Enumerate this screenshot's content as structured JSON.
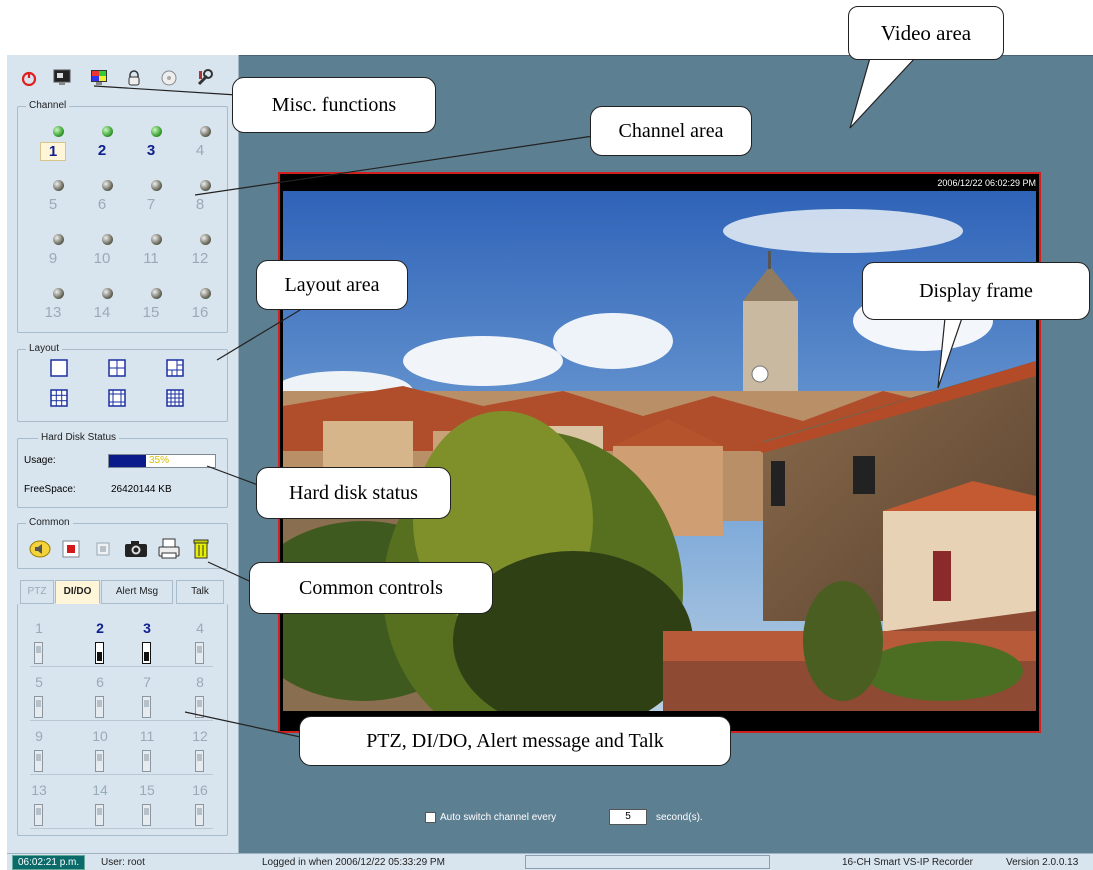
{
  "misc": {
    "icons": [
      "power-icon",
      "monitor-icon",
      "color-monitor-icon",
      "lock-icon",
      "disc-icon",
      "tools-icon"
    ]
  },
  "channel": {
    "title": "Channel",
    "items": [
      {
        "n": "1",
        "led": "on",
        "active": true,
        "selected": true
      },
      {
        "n": "2",
        "led": "on",
        "active": true
      },
      {
        "n": "3",
        "led": "on",
        "active": true
      },
      {
        "n": "4",
        "led": "off"
      },
      {
        "n": "5",
        "led": "off"
      },
      {
        "n": "6",
        "led": "off"
      },
      {
        "n": "7",
        "led": "off"
      },
      {
        "n": "8",
        "led": "off"
      },
      {
        "n": "9",
        "led": "off"
      },
      {
        "n": "10",
        "led": "off"
      },
      {
        "n": "11",
        "led": "off"
      },
      {
        "n": "12",
        "led": "off"
      },
      {
        "n": "13",
        "led": "off"
      },
      {
        "n": "14",
        "led": "off"
      },
      {
        "n": "15",
        "led": "off"
      },
      {
        "n": "16",
        "led": "off"
      }
    ]
  },
  "layout": {
    "title": "Layout",
    "options": [
      "layout-1x1-icon",
      "layout-2x2-icon",
      "layout-1plus3-icon",
      "layout-3x3-icon",
      "layout-1plus7-icon",
      "layout-4x4-icon"
    ]
  },
  "disk": {
    "title": "Hard Disk Status",
    "usage_label": "Usage:",
    "usage_text": "35%",
    "usage_fraction": 0.35,
    "free_label": "FreeSpace:",
    "free_value": "26420144 KB"
  },
  "common": {
    "title": "Common",
    "icons": [
      "speaker-icon",
      "record-icon",
      "stop-icon",
      "camera-icon",
      "print-icon",
      "trash-icon"
    ]
  },
  "tabs": [
    "PTZ",
    "DI/DO",
    "Alert Msg",
    "Talk"
  ],
  "dido": [
    {
      "n": "1"
    },
    {
      "n": "2",
      "active": true
    },
    {
      "n": "3",
      "active": true
    },
    {
      "n": "4"
    },
    {
      "n": "5"
    },
    {
      "n": "6"
    },
    {
      "n": "7"
    },
    {
      "n": "8"
    },
    {
      "n": "9"
    },
    {
      "n": "10"
    },
    {
      "n": "11"
    },
    {
      "n": "12"
    },
    {
      "n": "13"
    },
    {
      "n": "14"
    },
    {
      "n": "15"
    },
    {
      "n": "16"
    }
  ],
  "video": {
    "timestamp": "2006/12/22 06:02:29 PM"
  },
  "autoswitch": {
    "label": "Auto switch channel every",
    "seconds": "5",
    "suffix": "second(s)."
  },
  "status": {
    "time": "06:02:21 p.m.",
    "user": "User: root",
    "logged": "Logged in when  2006/12/22 05:33:29 PM",
    "product": "16-CH Smart VS-IP Recorder",
    "version": "Version 2.0.0.13"
  },
  "callouts": {
    "video_area": "Video area",
    "misc": "Misc. functions",
    "channel_area": "Channel area",
    "layout_area": "Layout area",
    "display_frame": "Display frame",
    "hard_disk": "Hard disk status",
    "common_controls": "Common controls",
    "ptz": "PTZ, DI/DO, Alert message and Talk"
  }
}
